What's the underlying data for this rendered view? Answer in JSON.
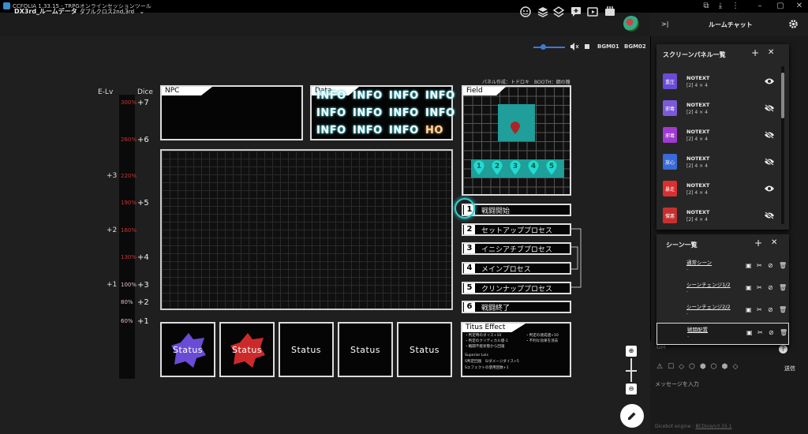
{
  "window": {
    "title": "CCFOLIA 1.33.15 - TRPGオンラインセッションツール"
  },
  "appbar": {
    "room_title": "DX3rd_ルームデータ",
    "room_subtitle": "ダブルクロス2nd,3rd"
  },
  "bgm": {
    "volume": 0.3,
    "labels": [
      "BGM01",
      "BGM02"
    ]
  },
  "scale": {
    "elv_title": "E-Lv",
    "dice_title": "Dice",
    "erosion_marks": [
      "300%",
      "260%",
      "220%",
      "190%",
      "160%",
      "130%",
      "100%",
      "80%",
      "60%"
    ],
    "dice_values": [
      "+7",
      "+6",
      "+5",
      "+4",
      "+3",
      "+2",
      "+1"
    ],
    "elv_values": [
      "+3",
      "+2",
      "+1"
    ]
  },
  "board": {
    "npc_title": "NPC",
    "data_title": "Data",
    "info_cells": [
      "INFO",
      "INFO",
      "INFO",
      "INFO",
      "INFO",
      "INFO",
      "INFO",
      "INFO",
      "INFO",
      "INFO",
      "INFO",
      "HO"
    ],
    "field_title": "Field",
    "credit": "パネル作成：トドロキ　BOOTH：鋼の雛",
    "field_numbers": [
      "1",
      "2",
      "3",
      "4",
      "5"
    ],
    "phases": [
      {
        "num": "1",
        "label": "戦闘開始"
      },
      {
        "num": "2",
        "label": "セットアッププロセス"
      },
      {
        "num": "3",
        "label": "イニシアチブプロセス"
      },
      {
        "num": "4",
        "label": "メインプロセス"
      },
      {
        "num": "5",
        "label": "クリンナッププロセス"
      },
      {
        "num": "6",
        "label": "戦闘終了"
      }
    ],
    "status_label": "Status",
    "titus_title": "Titus Effect",
    "titus_lines": [
      "・判定時のダイス+10",
      "・判定の達成値+10",
      "・判定のクリティカル値-1",
      "・不利な効果を消去",
      "・戦闘不能状態から回復",
      "Superior Lois",
      "S判定回復　S/ダメージダイス+5",
      "Sエフェクトの使用回数+1"
    ]
  },
  "right_panel": {
    "chat_title": "ルームチャット",
    "screen_panels_title": "スクリーンパネル一覧",
    "screen_panels": [
      {
        "name": "NOTEXT",
        "size": "[2] 4 × 4",
        "glyph": "重圧",
        "color": "#6a4bd6",
        "visible": true
      },
      {
        "name": "NOTEXT",
        "size": "[2] 4 × 4",
        "glyph": "邪毒",
        "color": "#7a5ad8",
        "visible": false
      },
      {
        "name": "NOTEXT",
        "size": "[2] 4 × 4",
        "glyph": "邪毒",
        "color": "#a03ad0",
        "visible": false
      },
      {
        "name": "NOTEXT",
        "size": "[2] 4 × 4",
        "glyph": "放心",
        "color": "#3a6ad8",
        "visible": false
      },
      {
        "name": "NOTEXT",
        "size": "[2] 4 × 4",
        "glyph": "暴走",
        "color": "#d83030",
        "visible": true
      },
      {
        "name": "NOTEXT",
        "size": "[2] 4 × 4",
        "glyph": "憎悪",
        "color": "#c83030",
        "visible": false
      }
    ],
    "scenes_title": "シーン一覧",
    "scenes": [
      {
        "name": "通常シーン",
        "sub": "-"
      },
      {
        "name": "シーンチェンジ1/2",
        "sub": "-"
      },
      {
        "name": "シーンチェンジ2/2",
        "sub": "-"
      },
      {
        "name": "戦闘配置",
        "sub": "-"
      }
    ],
    "chat_tab": "GM",
    "send_label": "送信",
    "message_placeholder": "メッセージを入力",
    "footer_label": "Dicebot engine : ",
    "footer_link": "BCDice/v3.15.1"
  }
}
